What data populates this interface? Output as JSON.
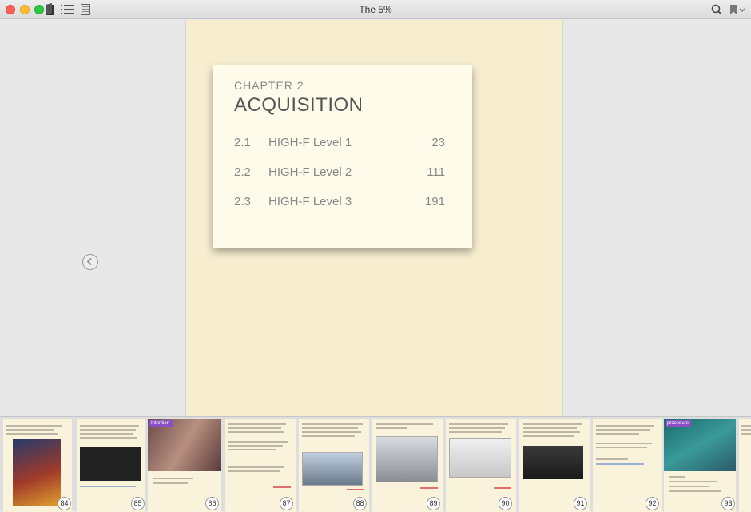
{
  "window": {
    "title": "The 5%"
  },
  "chapter": {
    "label": "CHAPTER 2",
    "title": "ACQUISITION",
    "sections": [
      {
        "number": "2.1",
        "title": "HIGH-F Level 1",
        "page": "23"
      },
      {
        "number": "2.2",
        "title": "HIGH-F Level 2",
        "page": "111"
      },
      {
        "number": "2.3",
        "title": "HIGH-F Level 3",
        "page": "191"
      }
    ]
  },
  "thumbnails": {
    "pages": [
      "84",
      "85",
      "86",
      "87",
      "88",
      "89",
      "90",
      "91",
      "92",
      "93"
    ],
    "badges": {
      "86": "Intention",
      "93": "procedure"
    }
  },
  "colors": {
    "page_background": "#f7eed0",
    "card_background": "#fefbea",
    "badge_purple": "#8a4fc4"
  },
  "icons": {
    "library": "book-icon",
    "toc": "list-icon",
    "view": "page-view-icon",
    "search": "search-icon",
    "bookmark": "bookmark-icon",
    "back": "chevron-left-icon"
  }
}
